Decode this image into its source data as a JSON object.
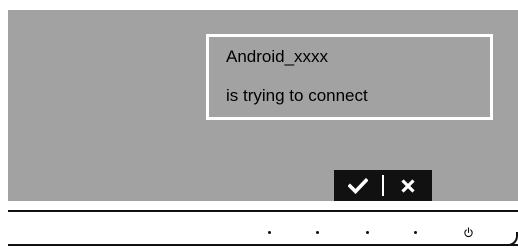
{
  "dialog": {
    "device_name": "Android_xxxx",
    "message": "is trying to connect"
  },
  "actions": {
    "accept_icon": "checkmark-icon",
    "reject_icon": "close-icon"
  },
  "hardware_buttons": [
    {
      "icon": "dot-button-icon"
    },
    {
      "icon": "dot-button-icon"
    },
    {
      "icon": "dot-button-icon"
    },
    {
      "icon": "dot-button-icon"
    },
    {
      "icon": "power-icon"
    }
  ],
  "colors": {
    "screen": "#a2a2a2",
    "frame": "#ffffff",
    "action_bar": "#111111"
  }
}
